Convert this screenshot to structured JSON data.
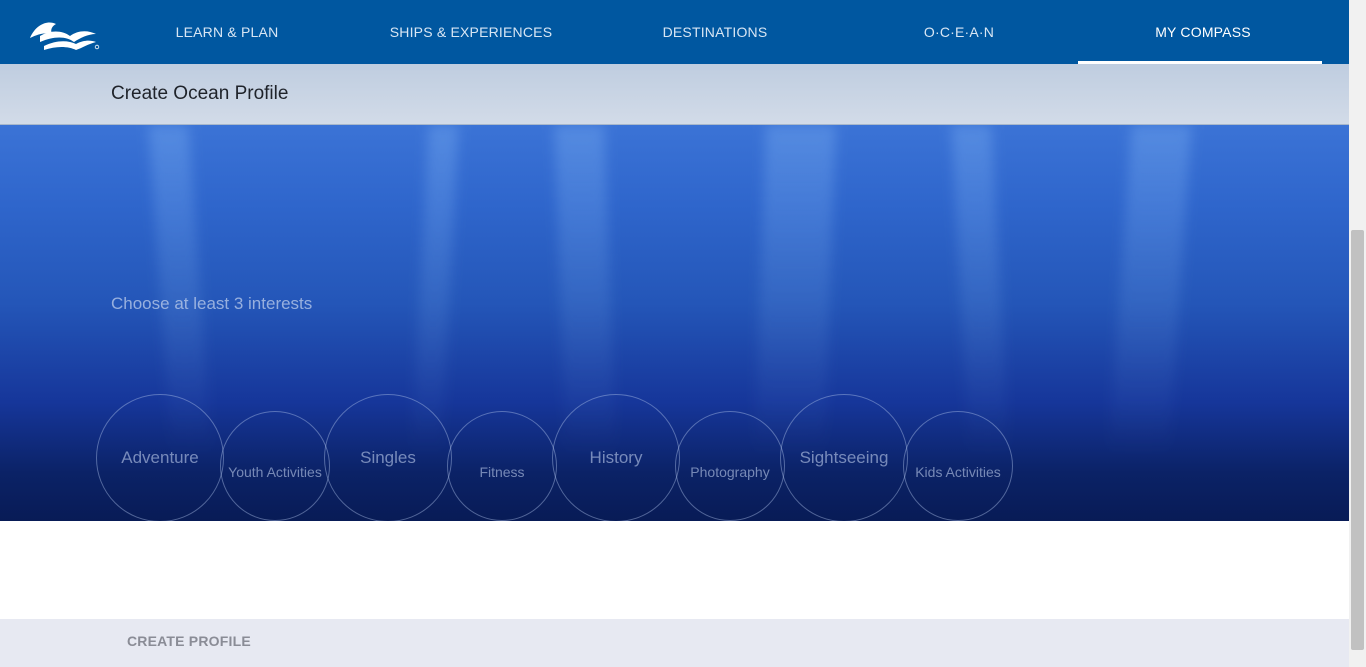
{
  "nav": {
    "logo_icon": "princess-sea-witch-logo-icon",
    "items": [
      {
        "label": "LEARN & PLAN"
      },
      {
        "label": "SHIPS & EXPERIENCES"
      },
      {
        "label": "DESTINATIONS"
      },
      {
        "label": "O·C·E·A·N"
      },
      {
        "label": "MY COMPASS"
      }
    ],
    "active_item": "MY COMPASS"
  },
  "subheader": {
    "title": "Create Ocean Profile"
  },
  "hero": {
    "prompt": "Choose at least 3 interests",
    "interests": [
      {
        "label": "Adventure"
      },
      {
        "label": "Youth Activities"
      },
      {
        "label": "Singles"
      },
      {
        "label": "Fitness"
      },
      {
        "label": "History"
      },
      {
        "label": "Photography"
      },
      {
        "label": "Sightseeing"
      },
      {
        "label": "Kids Activities"
      }
    ]
  },
  "footer": {
    "create_label": "CREATE PROFILE"
  },
  "colors": {
    "nav_bg": "#0057a0",
    "ocean_top": "#3b73d6",
    "ocean_bottom": "#081b56",
    "footer_bg": "#e7e9f2"
  }
}
